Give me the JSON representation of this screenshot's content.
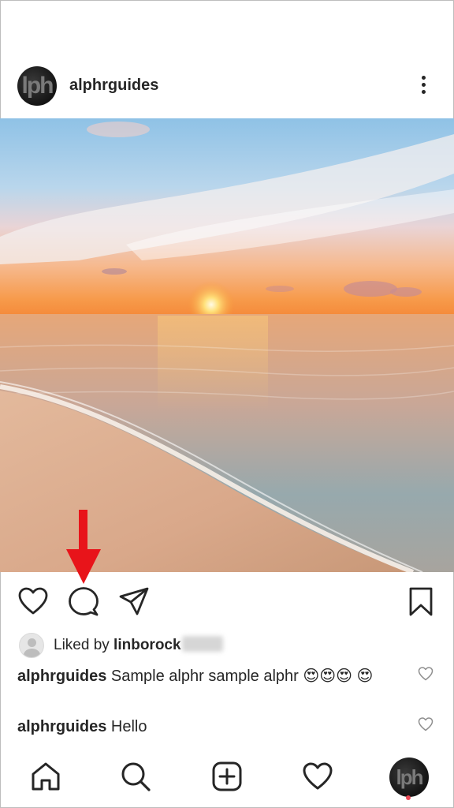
{
  "post": {
    "username": "alphrguides",
    "avatar_text": "lph",
    "more_icon": "more-vertical-icon",
    "image_alt": "Sunset over the ocean with waves washing onto a sandy beach"
  },
  "actions": {
    "like_icon": "heart-outline-icon",
    "comment_icon": "comment-bubble-icon",
    "share_icon": "paper-plane-icon",
    "save_icon": "bookmark-icon"
  },
  "likes": {
    "prefix": "Liked by ",
    "user": "linborock"
  },
  "comments": [
    {
      "user": "alphrguides",
      "text": " Sample alphr sample alphr 😍😍😍 😍"
    },
    {
      "user": "alphrguides",
      "text": " Hello"
    }
  ],
  "bottom_nav": [
    {
      "name": "home",
      "icon": "home-icon"
    },
    {
      "name": "search",
      "icon": "search-icon"
    },
    {
      "name": "create",
      "icon": "plus-square-icon"
    },
    {
      "name": "activity",
      "icon": "heart-outline-icon"
    },
    {
      "name": "profile",
      "icon": "profile-avatar"
    }
  ],
  "annotation": {
    "arrow_color": "#e8141a"
  },
  "colors": {
    "text": "#262626",
    "notification": "#ed4956"
  }
}
